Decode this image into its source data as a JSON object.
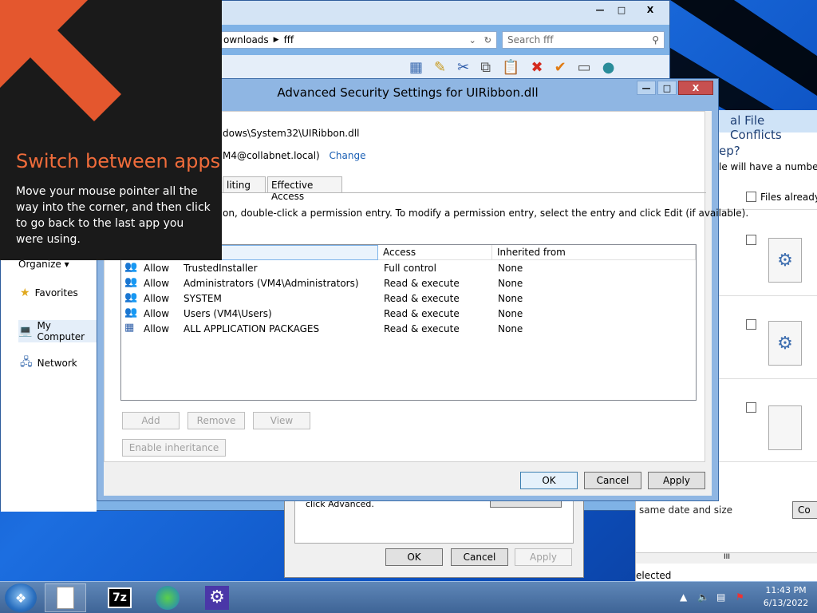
{
  "flyout": {
    "title": "Switch between apps",
    "body": "Move your mouse pointer all the way into the corner, and then click to go back to the last app you were using."
  },
  "explorer": {
    "address": {
      "crumb1": "ownloads",
      "crumb2": "fff"
    },
    "search_placeholder": "Search fff",
    "organize": "Organize ▾",
    "nav": [
      "Favorites",
      "My Computer",
      "Network"
    ],
    "caption": {
      "min": "—",
      "max": "□",
      "close": "X"
    }
  },
  "conflicts": {
    "title_fragment": "al File Conflicts",
    "question": "ep?",
    "desc": "le will have a number a",
    "files_already": "Files already i",
    "same_date": "same date and size",
    "c_button": "Co",
    "scroll_grip": "III",
    "selected": "elected"
  },
  "props": {
    "advanced_text": "click Advanced.",
    "ok": "OK",
    "cancel": "Cancel",
    "apply": "Apply"
  },
  "security_dialog": {
    "title": "Advanced Security Settings for UIRibbon.dll",
    "caption": {
      "min": "—",
      "max": "□",
      "close": "X"
    },
    "path": "dows\\System32\\UIRibbon.dll",
    "owner": "M4@collabnet.local)",
    "change_link": "Change",
    "tabs": [
      "liting",
      "Effective Access"
    ],
    "instructions": "on, double-click a permission entry. To modify a permission entry, select the entry and click Edit (if available).",
    "columns": [
      "",
      "Access",
      "Inherited from"
    ],
    "entries": [
      {
        "type": "Allow",
        "principal": "TrustedInstaller",
        "access": "Full control",
        "inherited": "None"
      },
      {
        "type": "Allow",
        "principal": "Administrators (VM4\\Administrators)",
        "access": "Read & execute",
        "inherited": "None"
      },
      {
        "type": "Allow",
        "principal": "SYSTEM",
        "access": "Read & execute",
        "inherited": "None"
      },
      {
        "type": "Allow",
        "principal": "Users (VM4\\Users)",
        "access": "Read & execute",
        "inherited": "None"
      },
      {
        "type": "Allow",
        "principal": "ALL APPLICATION PACKAGES",
        "access": "Read & execute",
        "inherited": "None"
      }
    ],
    "buttons": {
      "add": "Add",
      "remove": "Remove",
      "view": "View",
      "enable_inheritance": "Enable inheritance",
      "ok": "OK",
      "cancel": "Cancel",
      "apply": "Apply"
    }
  },
  "taskbar": {
    "apps": [
      "notepad-icon",
      "7zip-icon",
      "internet-download-icon",
      "settings-gear-icon"
    ],
    "sevenzip_label": "7z",
    "clock": {
      "time": "11:43 PM",
      "date": "6/13/2022"
    }
  },
  "colors": {
    "flyout_accent": "#f06c3b",
    "link": "#1a5fb4",
    "close_button": "#c75050"
  }
}
